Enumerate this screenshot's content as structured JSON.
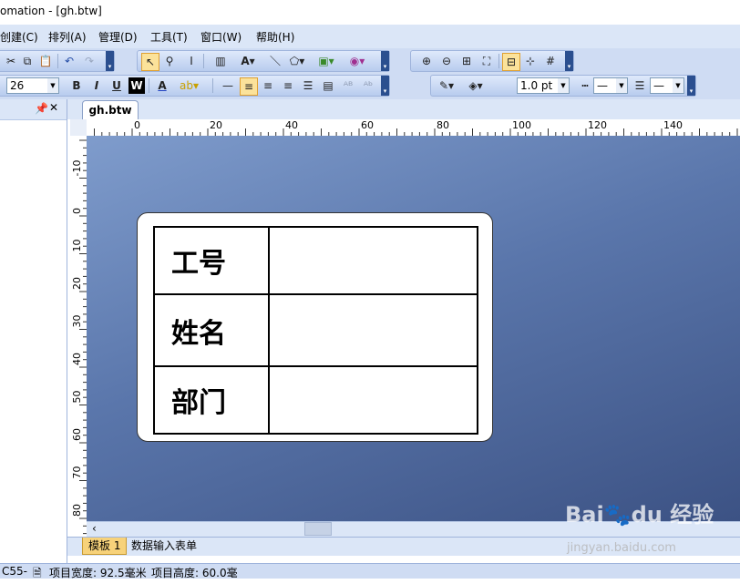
{
  "window": {
    "title": "omation - [gh.btw]"
  },
  "menu": [
    "创建(C)",
    "排列(A)",
    "管理(D)",
    "工具(T)",
    "窗口(W)",
    "帮助(H)"
  ],
  "toolbar": {
    "font_size": "26",
    "line_width": "1.0 pt",
    "bold": "B",
    "italic": "I",
    "underline": "U",
    "wordart": "W",
    "text_color": "A"
  },
  "tab": {
    "document": "gh.btw"
  },
  "ruler": {
    "h_labels": [
      "0",
      "20",
      "40",
      "60",
      "80",
      "100",
      "120",
      "140",
      "16"
    ],
    "v_labels": [
      "-10",
      "0",
      "10",
      "20",
      "30",
      "40",
      "50",
      "60",
      "70",
      "80"
    ]
  },
  "label": {
    "rows": [
      {
        "field": "工号",
        "value": ""
      },
      {
        "field": "姓名",
        "value": ""
      },
      {
        "field": "部门",
        "value": ""
      }
    ]
  },
  "sheet_tabs": [
    "模板 1",
    "数据输入表单"
  ],
  "status": {
    "code": "C55-",
    "width": "项目宽度: 92.5毫米",
    "height": "项目高度: 60.0毫"
  },
  "watermark": {
    "brand": "Baidu 经验",
    "url": "jingyan.baidu.com"
  },
  "colors": {
    "canvas_top": "#7f9ccc",
    "canvas_bottom": "#3c5284",
    "chrome": "#dbe6f7"
  }
}
